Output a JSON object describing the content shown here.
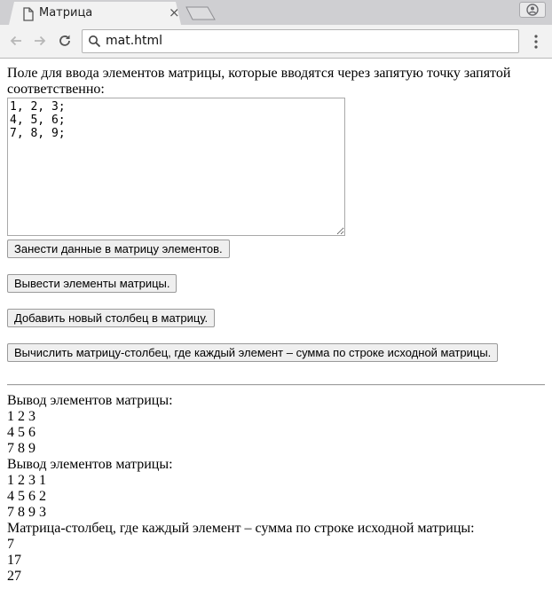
{
  "browser": {
    "tab_title": "Матрица",
    "tab_close": "×",
    "address": "mat.html",
    "icons": {
      "tab": "page-icon",
      "back": "arrow-left-icon",
      "forward": "arrow-right-icon",
      "reload": "reload-icon",
      "search": "search-icon",
      "menu": "kebab-menu-icon",
      "profile": "profile-icon"
    }
  },
  "page": {
    "instructions": "Поле для ввода элементов матрицы, которые вводятся через запятую точку запятой соответственно:",
    "textarea_value": "1, 2, 3;\n4, 5, 6;\n7, 8, 9;",
    "buttons": {
      "load": "Занести данные в матрицу элементов.",
      "print": "Вывести элементы матрицы.",
      "add_column": "Добавить новый столбец в матрицу.",
      "row_sums": "Вычислить матрицу-столбец, где каждый элемент – сумма по строке исходной матрицы."
    },
    "output": [
      "Вывод элементов матрицы:",
      "1 2 3",
      "4 5 6",
      "7 8 9",
      "Вывод элементов матрицы:",
      "1 2 3 1",
      "4 5 6 2",
      "7 8 9 3",
      "Матрица-столбец, где каждый элемент – сумма по строке исходной матрицы:",
      "7",
      "17",
      "27"
    ]
  }
}
